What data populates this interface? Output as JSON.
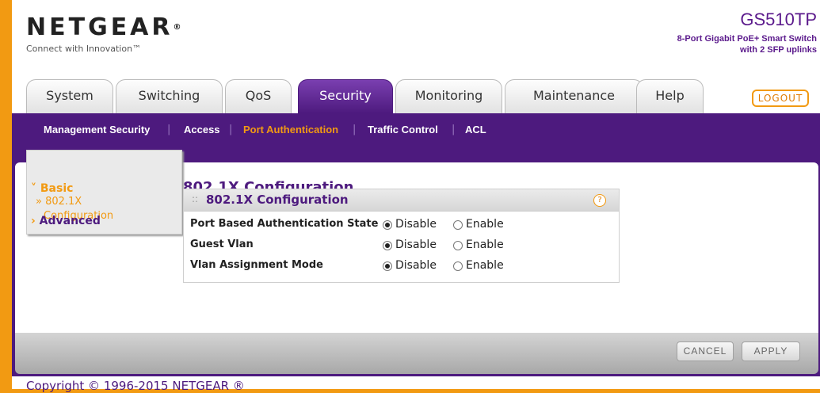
{
  "brand": {
    "logo": "NETGEAR",
    "logo_mark": "®",
    "tagline": "Connect with Innovation™",
    "model": "GS510TP",
    "model_desc_line1": "8-Port Gigabit PoE+ Smart Switch",
    "model_desc_line2": "with 2 SFP uplinks"
  },
  "tabs": [
    {
      "label": "System"
    },
    {
      "label": "Switching"
    },
    {
      "label": "QoS"
    },
    {
      "label": "Security"
    },
    {
      "label": "Monitoring"
    },
    {
      "label": "Maintenance"
    },
    {
      "label": "Help"
    }
  ],
  "active_tab": "Security",
  "logout_label": "LOGOUT",
  "subnav": [
    {
      "label": "Management Security"
    },
    {
      "label": "Access"
    },
    {
      "label": "Port Authentication"
    },
    {
      "label": "Traffic Control"
    },
    {
      "label": "ACL"
    }
  ],
  "sidebar": {
    "basic": "Basic",
    "basic_child": "» 802.1X",
    "basic_child_line2": "Configuration",
    "advanced": "Advanced"
  },
  "page_title": "802.1X Configuration",
  "panel": {
    "title": "802.1X Configuration",
    "grip": "::",
    "help": "?",
    "rows": [
      {
        "label": "Port Based Authentication State",
        "options": [
          "Disable",
          "Enable"
        ],
        "selected": "Disable"
      },
      {
        "label": "Guest Vlan",
        "options": [
          "Disable",
          "Enable"
        ],
        "selected": "Disable"
      },
      {
        "label": "Vlan Assignment Mode",
        "options": [
          "Disable",
          "Enable"
        ],
        "selected": "Disable"
      }
    ]
  },
  "buttons": {
    "cancel": "CANCEL",
    "apply": "APPLY"
  },
  "copyright": "Copyright © 1996-2015 NETGEAR ®",
  "colors": {
    "accent_orange": "#f29a12",
    "brand_purple": "#4d1a7e"
  }
}
